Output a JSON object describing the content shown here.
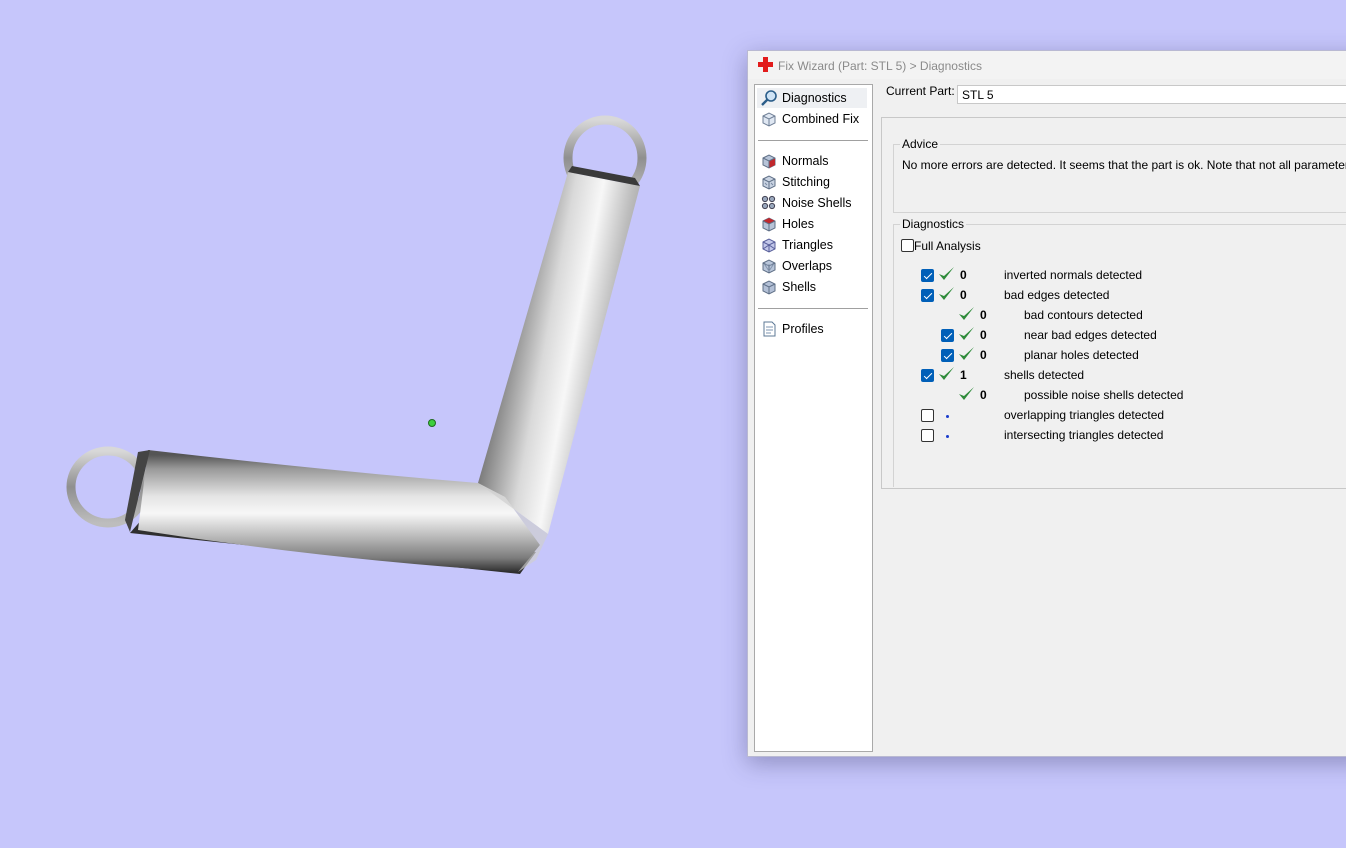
{
  "window": {
    "title": "Fix Wizard (Part: STL 5) > Diagnostics",
    "app_icon": "red-cross-icon"
  },
  "sidebar": {
    "items": [
      {
        "label": "Diagnostics",
        "icon": "magnifier-icon",
        "active": true
      },
      {
        "label": "Combined Fix",
        "icon": "cube-outline-icon"
      },
      {
        "label": "Normals",
        "icon": "normals-cube-icon"
      },
      {
        "label": "Stitching",
        "icon": "stitching-cube-icon"
      },
      {
        "label": "Noise Shells",
        "icon": "noise-shells-icon"
      },
      {
        "label": "Holes",
        "icon": "holes-cube-icon"
      },
      {
        "label": "Triangles",
        "icon": "triangles-cube-icon"
      },
      {
        "label": "Overlaps",
        "icon": "overlaps-cube-icon"
      },
      {
        "label": "Shells",
        "icon": "shells-cube-icon"
      },
      {
        "label": "Profiles",
        "icon": "document-icon"
      }
    ]
  },
  "current_part": {
    "label": "Current Part:",
    "value": "STL 5"
  },
  "advice": {
    "title": "Advice",
    "text": "No more errors are detected. It seems that the part is ok. Note that not all parameters were"
  },
  "diagnostics": {
    "title": "Diagnostics",
    "full_analysis": {
      "label": "Full Analysis",
      "checked": false
    },
    "rows": [
      {
        "checked": true,
        "status": "ok",
        "count": "0",
        "label": "inverted normals detected",
        "indent": 0
      },
      {
        "checked": true,
        "status": "ok",
        "count": "0",
        "label": "bad edges detected",
        "indent": 0
      },
      {
        "checked": null,
        "status": "ok",
        "count": "0",
        "label": "bad contours detected",
        "indent": 1
      },
      {
        "checked": true,
        "status": "ok",
        "count": "0",
        "label": "near bad edges detected",
        "indent": 1
      },
      {
        "checked": true,
        "status": "ok",
        "count": "0",
        "label": "planar holes detected",
        "indent": 1
      },
      {
        "checked": true,
        "status": "ok",
        "count": "1",
        "label": "shells detected",
        "indent": 0
      },
      {
        "checked": null,
        "status": "ok",
        "count": "0",
        "label": "possible noise shells detected",
        "indent": 1
      },
      {
        "checked": false,
        "status": "not-run",
        "count": "",
        "label": "overlapping triangles detected",
        "indent": 0
      },
      {
        "checked": false,
        "status": "not-run",
        "count": "",
        "label": "intersecting triangles detected",
        "indent": 0
      }
    ]
  },
  "viewport": {
    "model": "bent-tube-with-loops",
    "pivot_marker": "green-dot-icon",
    "background_color": "#c6c6fb"
  },
  "colors": {
    "check_green": "#2e8b3a",
    "checkbox_blue": "#005fb8",
    "accent_red": "#e21b1b"
  }
}
